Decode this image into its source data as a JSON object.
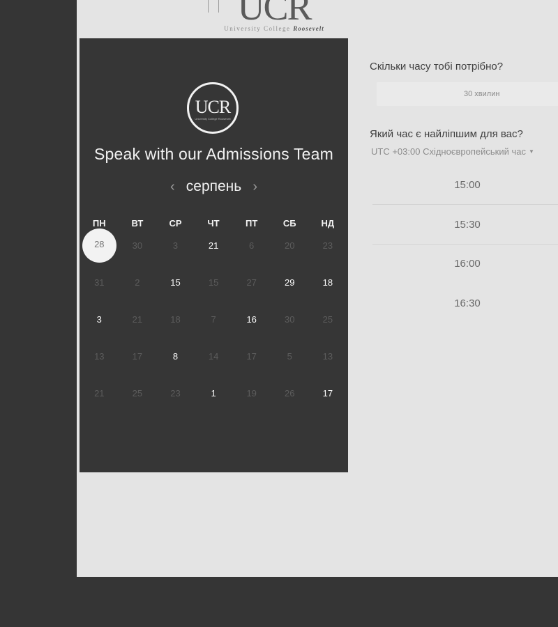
{
  "header": {
    "logo_mark": "UCR",
    "logo_sub_prefix": "University College",
    "logo_sub_name": "Roosevelt"
  },
  "calendar": {
    "logo_mark": "UCR",
    "logo_sub": "University College Roosevelt",
    "title": "Speak with our Admissions Team",
    "month": "серпень",
    "prev_icon": "‹",
    "next_icon": "›",
    "weekdays": [
      "ПН",
      "ВТ",
      "СР",
      "ЧТ",
      "ПТ",
      "СБ",
      "НД"
    ],
    "weeks": [
      [
        {
          "d": "28",
          "s": "selected"
        },
        {
          "d": "30",
          "s": "dim"
        },
        {
          "d": "3",
          "s": "dim"
        },
        {
          "d": "21",
          "s": "bright"
        },
        {
          "d": "6",
          "s": "dim"
        },
        {
          "d": "20",
          "s": "dim"
        },
        {
          "d": "23",
          "s": "dim"
        }
      ],
      [
        {
          "d": "31",
          "s": "dim"
        },
        {
          "d": "2",
          "s": "dim"
        },
        {
          "d": "15",
          "s": "bright"
        },
        {
          "d": "15",
          "s": "dim"
        },
        {
          "d": "27",
          "s": "dim"
        },
        {
          "d": "29",
          "s": "bright"
        },
        {
          "d": "18",
          "s": "bright"
        }
      ],
      [
        {
          "d": "3",
          "s": "bright"
        },
        {
          "d": "21",
          "s": "dim"
        },
        {
          "d": "18",
          "s": "dim"
        },
        {
          "d": "7",
          "s": "dim"
        },
        {
          "d": "16",
          "s": "bright"
        },
        {
          "d": "30",
          "s": "dim"
        },
        {
          "d": "25",
          "s": "dim"
        }
      ],
      [
        {
          "d": "13",
          "s": "dim"
        },
        {
          "d": "17",
          "s": "dim"
        },
        {
          "d": "8",
          "s": "bright"
        },
        {
          "d": "14",
          "s": "dim"
        },
        {
          "d": "17",
          "s": "dim"
        },
        {
          "d": "5",
          "s": "dim"
        },
        {
          "d": "13",
          "s": "dim"
        }
      ],
      [
        {
          "d": "21",
          "s": "dim"
        },
        {
          "d": "25",
          "s": "dim"
        },
        {
          "d": "23",
          "s": "dim"
        },
        {
          "d": "1",
          "s": "bright"
        },
        {
          "d": "19",
          "s": "dim"
        },
        {
          "d": "26",
          "s": "dim"
        },
        {
          "d": "17",
          "s": "bright"
        }
      ]
    ]
  },
  "booking": {
    "duration_question": "Скільки часу тобі потрібно?",
    "duration_value": "30 хвилин",
    "time_question": "Який час є найліпшим для вас?",
    "timezone": "UTC +03:00 Східноєвропейський час",
    "timezone_caret": "▼",
    "slots": [
      "15:00",
      "15:30",
      "16:00",
      "16:30"
    ]
  },
  "colors": {
    "frame": "#353535",
    "page_bg": "#e4e4e4",
    "calendar_bg": "#363636",
    "selected_day": "#f2f2f2"
  }
}
